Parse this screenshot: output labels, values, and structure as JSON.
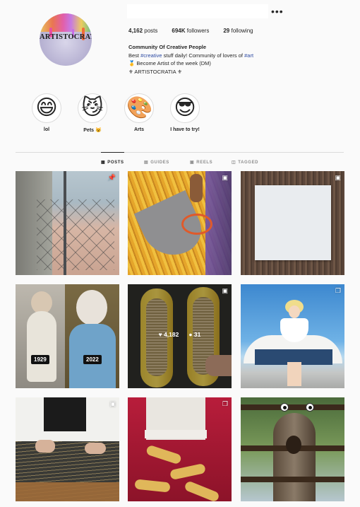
{
  "profile": {
    "avatar_logo_text": "ARTISTOCRATIA",
    "more_icon": "•••",
    "stats": {
      "posts_value": "4,162",
      "posts_label": "posts",
      "followers_value": "694K",
      "followers_label": "followers",
      "following_value": "29",
      "following_label": "following"
    },
    "bio": {
      "name": "Community Of Creative People",
      "line1_pre": "Best ",
      "line1_tag1": "#creative",
      "line1_mid": " stuff daily! Community of lovers of ",
      "line1_tag2": "#art",
      "line2": "🥇 Become Artist of the week (DM)",
      "line3": "⚜ ARTISTOCRATIA ⚜"
    }
  },
  "highlights": [
    {
      "label": "lol",
      "emoji": "😄"
    },
    {
      "label": "Pets 😺",
      "emoji": "😼"
    },
    {
      "label": "Arts",
      "emoji": "🎨"
    },
    {
      "label": "I have to try!",
      "emoji": "😎"
    }
  ],
  "tabs": [
    {
      "label": "POSTS",
      "icon": "grid-icon",
      "glyph": "▦",
      "active": true
    },
    {
      "label": "GUIDES",
      "icon": "guides-icon",
      "glyph": "▤",
      "active": false
    },
    {
      "label": "REELS",
      "icon": "reels-icon",
      "glyph": "▣",
      "active": false
    },
    {
      "label": "TAGGED",
      "icon": "tagged-icon",
      "glyph": "◫",
      "active": false
    }
  ],
  "posts": {
    "queen_year_left": "1929",
    "queen_year_right": "2022",
    "hover_likes": "4,182",
    "hover_comments": "31",
    "heart_glyph": "♥",
    "comment_glyph": "●",
    "pin_glyph": "📌",
    "reel_glyph": "▣",
    "carousel_glyph": "❐"
  },
  "colors": {
    "hashtag": "#2c4aa3",
    "divider": "#dbdbdb",
    "text": "#262626",
    "muted": "#8e8e8e"
  }
}
